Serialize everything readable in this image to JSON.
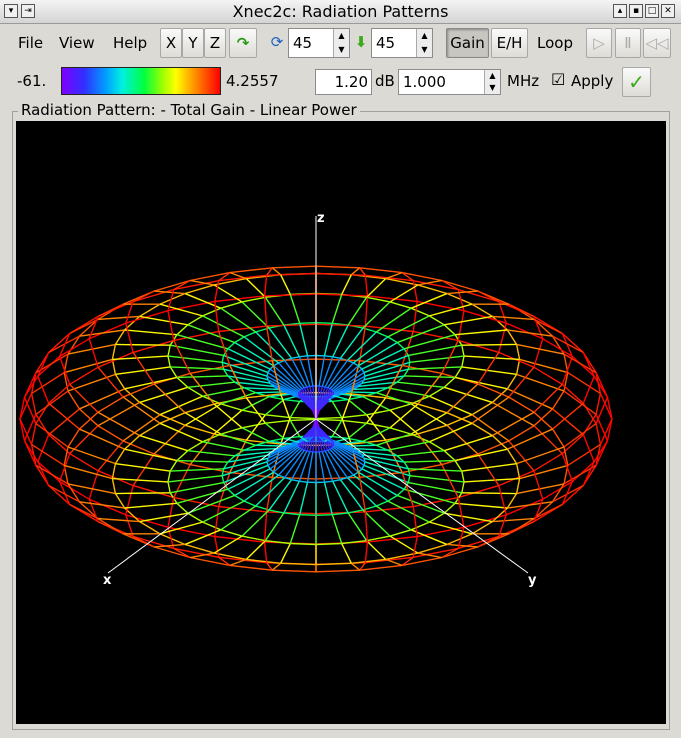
{
  "window": {
    "title": "Xnec2c: Radiation Patterns"
  },
  "menu": {
    "file": "File",
    "view": "View",
    "help": "Help"
  },
  "toolbar": {
    "x": "X",
    "y": "Y",
    "z": "Z",
    "rotate_value": "45",
    "incline_value": "45",
    "gain": "Gain",
    "eh": "E/H",
    "loop": "Loop"
  },
  "scale": {
    "min": "-61.",
    "max": "4.2557"
  },
  "freq": {
    "step": "1.20",
    "unit": "dB",
    "value": "1.000",
    "mhz": "MHz",
    "apply": "Apply"
  },
  "frame": {
    "label": "Radiation Pattern:  - Total Gain - Linear Power"
  },
  "axes": {
    "x": "x",
    "y": "y",
    "z": "z"
  },
  "colors": {
    "viewport_bg": "#000000",
    "axis": "#ffffff"
  }
}
